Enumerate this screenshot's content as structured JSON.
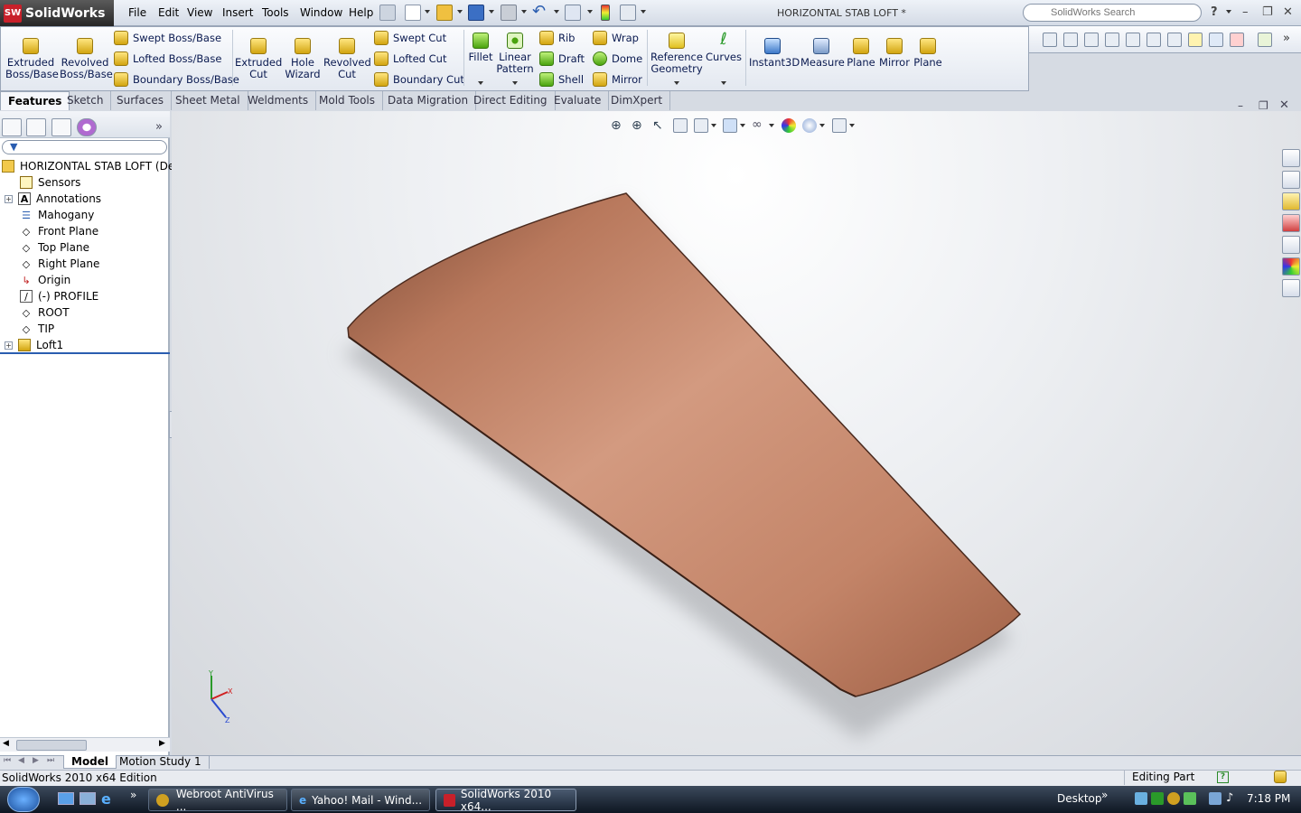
{
  "app": {
    "name": "SolidWorks",
    "logo_badge": "SW",
    "document_title": "HORIZONTAL STAB LOFT *"
  },
  "menu": [
    "File",
    "Edit",
    "View",
    "Insert",
    "Tools",
    "Window",
    "Help"
  ],
  "search": {
    "placeholder": "SolidWorks Search"
  },
  "window_controls": {
    "help": "?",
    "minimize": "–",
    "restore": "❐",
    "close": "✕"
  },
  "commands": {
    "extruded_boss": "Extruded\nBoss/Base",
    "revolved_boss": "Revolved\nBoss/Base",
    "swept_boss": "Swept Boss/Base",
    "lofted_boss": "Lofted Boss/Base",
    "boundary_boss": "Boundary Boss/Base",
    "extruded_cut": "Extruded\nCut",
    "hole_wizard": "Hole\nWizard",
    "revolved_cut": "Revolved\nCut",
    "swept_cut": "Swept Cut",
    "lofted_cut": "Lofted Cut",
    "boundary_cut": "Boundary Cut",
    "fillet": "Fillet",
    "linear_pattern": "Linear\nPattern",
    "rib": "Rib",
    "draft": "Draft",
    "shell": "Shell",
    "wrap": "Wrap",
    "dome": "Dome",
    "mirror_small": "Mirror",
    "reference_geometry": "Reference\nGeometry",
    "curves": "Curves",
    "instant3d": "Instant3D",
    "measure": "Measure",
    "plane1": "Plane",
    "mirror": "Mirror",
    "plane2": "Plane"
  },
  "tabs": [
    "Features",
    "Sketch",
    "Surfaces",
    "Sheet Metal",
    "Weldments",
    "Mold Tools",
    "Data Migration",
    "Direct Editing",
    "Evaluate",
    "DimXpert"
  ],
  "tree": {
    "root": "HORIZONTAL STAB LOFT  (Def",
    "items": [
      "Sensors",
      "Annotations",
      "Mahogany",
      "Front Plane",
      "Top Plane",
      "Right Plane",
      "Origin",
      "(-) PROFILE",
      "ROOT",
      "TIP",
      "Loft1"
    ]
  },
  "triad": {
    "x": "X",
    "y": "Y",
    "z": "Z"
  },
  "bottom_tabs": [
    "Model",
    "Motion Study 1"
  ],
  "status": {
    "left": "SolidWorks 2010 x64 Edition",
    "right": "Editing Part",
    "help": "?"
  },
  "taskbar": {
    "items": [
      "Webroot AntiVirus ...",
      "Yahoo! Mail - Wind...",
      "SolidWorks 2010 x64..."
    ],
    "desktop": "Desktop",
    "more": "»",
    "time": "7:18 PM"
  },
  "colors": {
    "wood_light": "#c98b6e",
    "wood_dark": "#8a4f36",
    "accent": "#2a5db0"
  }
}
